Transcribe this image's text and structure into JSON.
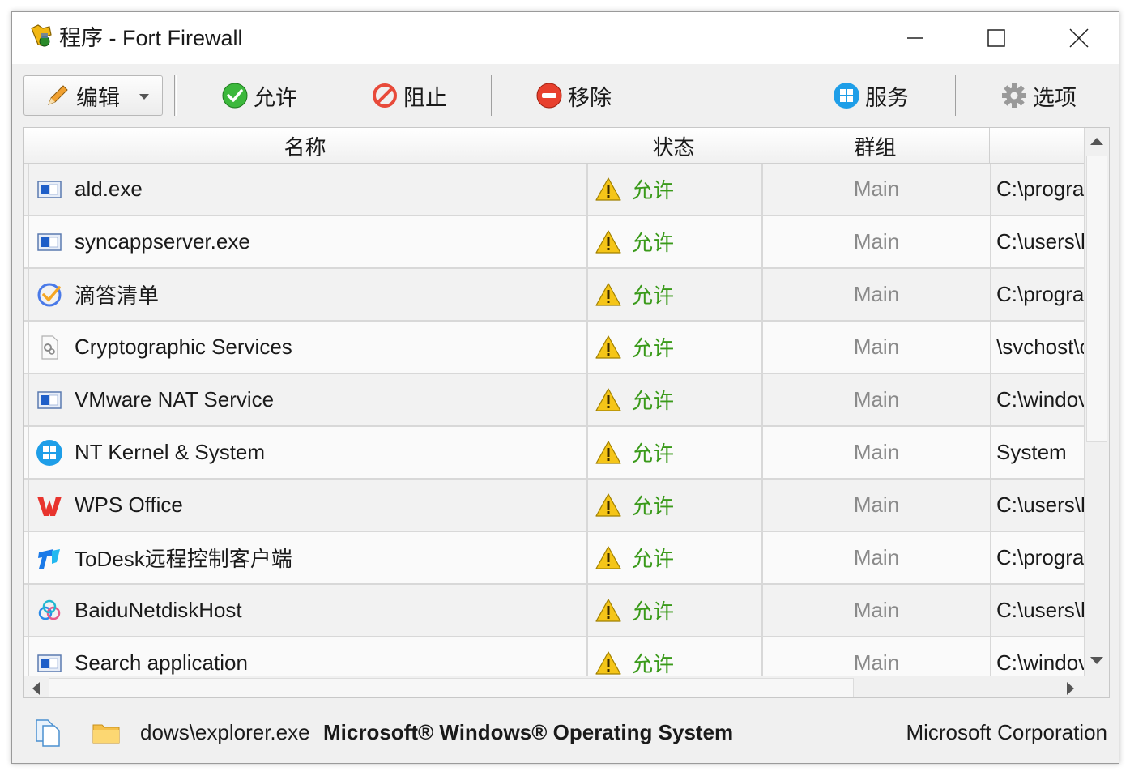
{
  "window": {
    "title": "程序 - Fort Firewall"
  },
  "toolbar": {
    "edit_label": "编辑",
    "allow_label": "允许",
    "block_label": "阻止",
    "remove_label": "移除",
    "services_label": "服务",
    "options_label": "选项"
  },
  "table": {
    "columns": [
      "名称",
      "状态",
      "群组",
      ""
    ],
    "rows": [
      {
        "name": "ald.exe",
        "icon": "app-window-icon",
        "status": "允许",
        "group": "Main",
        "path": "C:\\progra"
      },
      {
        "name": "syncappserver.exe",
        "icon": "app-window-icon",
        "status": "允许",
        "group": "Main",
        "path": "C:\\users\\l"
      },
      {
        "name": "滴答清单",
        "icon": "ticktick-icon",
        "status": "允许",
        "group": "Main",
        "path": "C:\\progra"
      },
      {
        "name": "Cryptographic Services",
        "icon": "service-file-icon",
        "status": "允许",
        "group": "Main",
        "path": "\\svchost\\c"
      },
      {
        "name": "VMware NAT Service",
        "icon": "app-window-icon",
        "status": "允许",
        "group": "Main",
        "path": "C:\\windov"
      },
      {
        "name": "NT Kernel & System",
        "icon": "windows-logo-icon",
        "status": "允许",
        "group": "Main",
        "path": "System"
      },
      {
        "name": "WPS Office",
        "icon": "wps-icon",
        "status": "允许",
        "group": "Main",
        "path": "C:\\users\\l"
      },
      {
        "name": "ToDesk远程控制客户端",
        "icon": "todesk-icon",
        "status": "允许",
        "group": "Main",
        "path": "C:\\progra"
      },
      {
        "name": "BaiduNetdiskHost",
        "icon": "baidu-netdisk-icon",
        "status": "允许",
        "group": "Main",
        "path": "C:\\users\\l"
      },
      {
        "name": "Search application",
        "icon": "app-window-icon",
        "status": "允许",
        "group": "Main",
        "path": "C:\\windov"
      }
    ]
  },
  "statusbar": {
    "path": "dows\\explorer.exe",
    "product": "Microsoft® Windows® Operating System",
    "company": "Microsoft Corporation"
  },
  "colors": {
    "allow_green": "#3a9a1a",
    "group_gray": "#8a8a8a",
    "warning_yellow": "#f5c518"
  }
}
